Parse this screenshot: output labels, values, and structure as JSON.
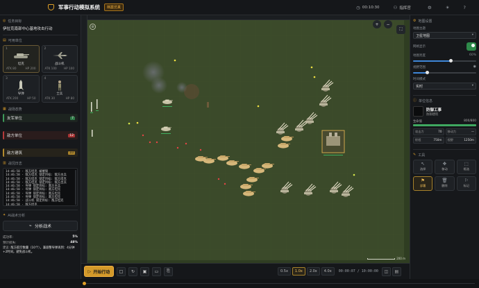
{
  "topbar": {
    "title": "军事行动模拟系统",
    "mode_badge": "档案仿真",
    "time": "00:10:30",
    "commander": "指挥官"
  },
  "mission": {
    "section_label": "任务目标",
    "text": "伊拉克南部中心基地攻击行动"
  },
  "units_section": {
    "label": "可用单位",
    "units": [
      {
        "index": "1",
        "name": "坦克",
        "atk": "ATK 80",
        "hp": "HP 200",
        "icon": "tank-icon"
      },
      {
        "index": "2",
        "name": "战斗机",
        "atk": "ATK 100",
        "hp": "HP 100",
        "icon": "fighter-jet-icon"
      },
      {
        "index": "3",
        "name": "导弹",
        "atk": "ATK 200",
        "hp": "HP 50",
        "icon": "missile-icon"
      },
      {
        "index": "4",
        "name": "士兵",
        "atk": "ATK 30",
        "hp": "HP 80",
        "icon": "soldier-icon"
      }
    ]
  },
  "situation": {
    "label": "战场态势",
    "rows": [
      {
        "label": "友军单位",
        "count": "7"
      },
      {
        "label": "敌方单位",
        "count": "12"
      },
      {
        "label": "敌方建筑",
        "count": "10"
      }
    ]
  },
  "log": {
    "label": "战况日志",
    "lines": [
      "14:46:58 - 敌方坦克 被摧毁",
      "14:46:58 - 敌方坦克 锁定目标: 敌方主兵",
      "14:46:58 - 敌方坦克 锁定目标: 敌方坦克",
      "14:46:58 - 敌方坦克 锁定目标: 敌方主兵",
      "14:46:58 - 导弹 锁定目标: 敌方主兵",
      "14:46:58 - 导弹 锁定目标: 敌方坦克",
      "14:46:58 - 导弹 锁定目标: 敌方坦克",
      "14:46:58 - 导弹 锁定目标: 敌方坦克",
      "14:46:58 - 战斗机 锁定目标: 敌方坦克",
      "14:46:58 - 敌方坦克",
      "14:46:58 - 敌军暂停"
    ]
  },
  "ai": {
    "label": "AI战术分析",
    "button_label": "分析战术",
    "success_label": "成功率:",
    "success_value": "5%",
    "loss_label": "预计损失:",
    "loss_value": "48%",
    "advice_label": "建议:",
    "advice_text": "敌方航空数量（10个），兼容整导弹再到：4分钟+2时间，避免战斗机。"
  },
  "map": {
    "zoom_in": "+",
    "zoom_out": "−",
    "scale_label": "200 m"
  },
  "map_settings": {
    "label": "地图设置",
    "theme_label": "地图主题",
    "theme_value": "卫星地图",
    "grid_label": "网格显示",
    "opacity_label": "地图亮度",
    "opacity_value": "60%",
    "opacity_fraction": 0.6,
    "view_label": "视野范围",
    "view_fraction": 0.22,
    "time_label": "时间模式",
    "time_value": "实时"
  },
  "unit_info": {
    "label": "单位信息",
    "name": "防御工事",
    "sub": "防御建筑",
    "hp_label": "生命值",
    "hp_value": "800/800",
    "hp_fraction": 1.0,
    "stats": [
      {
        "label": "攻击力",
        "value": "70"
      },
      {
        "label": "移动力",
        "value": "—"
      },
      {
        "label": "射程",
        "value": "750m"
      },
      {
        "label": "视野",
        "value": "1250m"
      }
    ]
  },
  "tools": {
    "label": "工具",
    "items": [
      {
        "label": "选择",
        "icon": "pointer-icon"
      },
      {
        "label": "移动",
        "icon": "move-icon"
      },
      {
        "label": "框选",
        "icon": "select-box-icon"
      },
      {
        "label": "部署",
        "icon": "deploy-icon"
      },
      {
        "label": "删除",
        "icon": "trash-icon"
      },
      {
        "label": "标记",
        "icon": "flag-icon"
      }
    ]
  },
  "bottom": {
    "start_label": "开始行动",
    "speeds": [
      "0.5x",
      "1.0x",
      "2.0x",
      "4.0x"
    ],
    "active_speed": "1.0x",
    "timer": "00:00:07 / 10:00:00"
  },
  "colors": {
    "accent": "#d49a2a",
    "friend": "#3e9a5a",
    "enemy": "#b53a3a",
    "map_ground": "#3a4a2a"
  }
}
